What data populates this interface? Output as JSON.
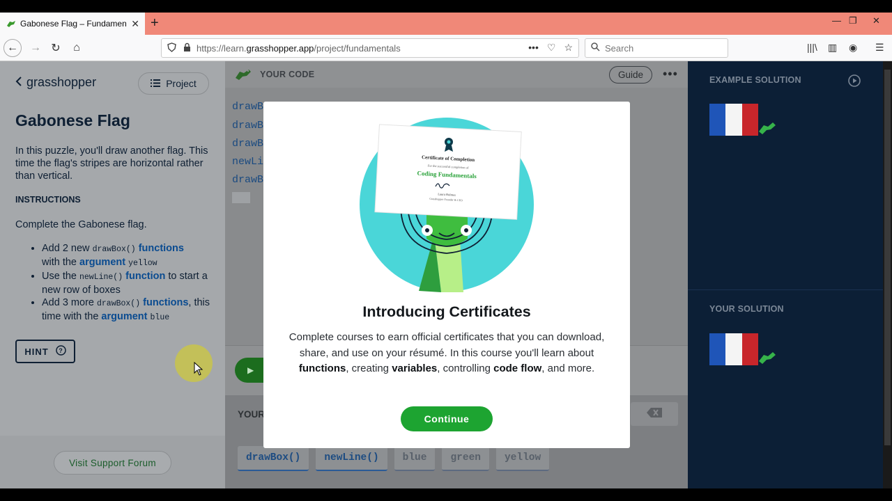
{
  "browser": {
    "tab_title": "Gabonese Flag – Fundamentals",
    "url_prefix": "https://learn.",
    "url_domain": "grasshopper.app",
    "url_path": "/project/fundamentals",
    "search_placeholder": "Search"
  },
  "left": {
    "logo": "grasshopper",
    "project_button": "Project",
    "title": "Gabonese Flag",
    "description": "In this puzzle, you'll draw another flag. This time the flag's stripes are horizontal rather than vertical.",
    "instructions_heading": "INSTRUCTIONS",
    "complete_line": "Complete the Gabonese flag.",
    "i1": {
      "a": "Add 2 new ",
      "code": "drawBox()",
      "kw": "functions",
      "b": "with the ",
      "kw2": "argument",
      "code2": "yellow"
    },
    "i2": {
      "a": "Use the ",
      "code": "newLine()",
      "kw": "function",
      "b": " to start a new row of boxes"
    },
    "i3": {
      "a": "Add 3 more ",
      "code": "drawBox()",
      "kw": "functions",
      "b": ", this time with the ",
      "kw2": "argument",
      "code2": "blue"
    },
    "hint_label": "HINT",
    "forum_button": "Visit Support Forum"
  },
  "editor": {
    "header_label": "YOUR CODE",
    "guide_button": "Guide",
    "code_lines": [
      "drawB",
      "drawB",
      "drawB",
      "newLi",
      "drawB"
    ],
    "your_label": "YOUR",
    "keys": [
      "drawBox()",
      "newLine()",
      "blue",
      "green",
      "yellow"
    ]
  },
  "right": {
    "example_label": "EXAMPLE SOLUTION",
    "your_label": "YOUR SOLUTION",
    "flag_colors": [
      "#1f55b8",
      "#f4f4f4",
      "#c8262b"
    ]
  },
  "modal": {
    "cert_title": "Certificate of Completion",
    "cert_sub": "For the successful completion of",
    "cert_course": "Coding Fundamentals",
    "cert_signer": "Laura Holmes",
    "cert_role": "Grasshopper Founder & CEO",
    "title": "Introducing Certificates",
    "body_1": "Complete courses to earn official certificates that you can download, share, and use on your résumé. In this course you'll learn about ",
    "body_functions": "functions",
    "body_2": ", creating ",
    "body_variables": "variables",
    "body_3": ", controlling ",
    "body_codeflow": "code flow",
    "body_4": ", and more.",
    "continue_button": "Continue"
  }
}
